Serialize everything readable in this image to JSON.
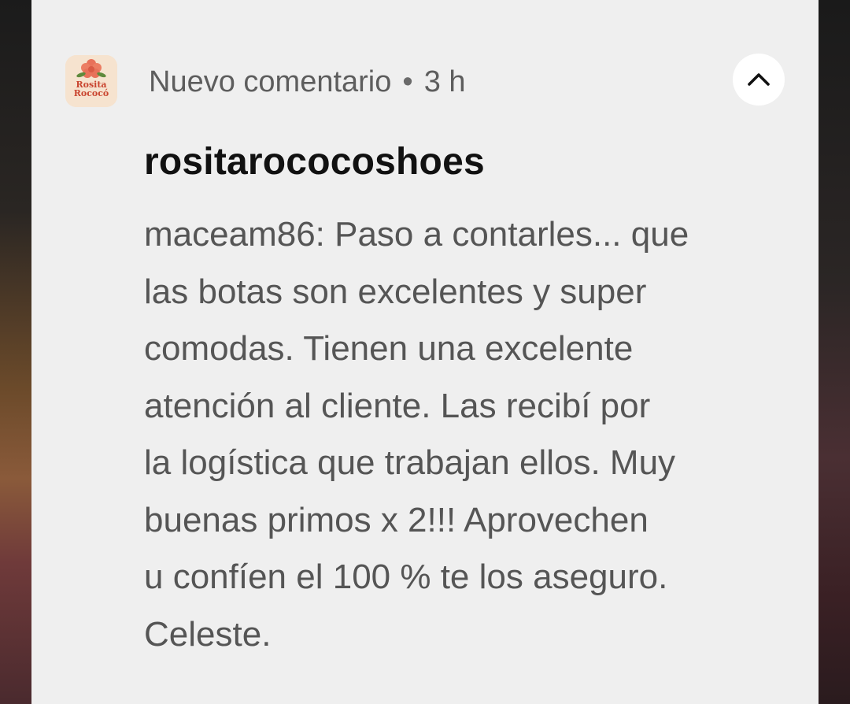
{
  "notification": {
    "app_icon": {
      "name": "rosita-rococo-logo-icon",
      "logo_text_line1": "Rosita",
      "logo_text_line2": "Rococó"
    },
    "header": {
      "label": "Nuevo comentario",
      "separator": "•",
      "time": "3 h"
    },
    "collapse_icon": "chevron-up-icon",
    "title": "rositarococoshoes",
    "body_lines": [
      "maceam86: Paso a contarles... que",
      "las botas son excelentes y super",
      "comodas. Tienen una excelente",
      "atención al cliente. Las recibí por",
      "la logística que trabajan ellos. Muy",
      "buenas primos x 2!!! Aprovechen",
      "u confíen el 100 % te los aseguro.",
      "Celeste."
    ]
  },
  "colors": {
    "card_background": "#efefef",
    "title": "#111111",
    "body_text": "#555555",
    "header_text": "#5d5d5d",
    "logo_accent": "#e8715a"
  }
}
